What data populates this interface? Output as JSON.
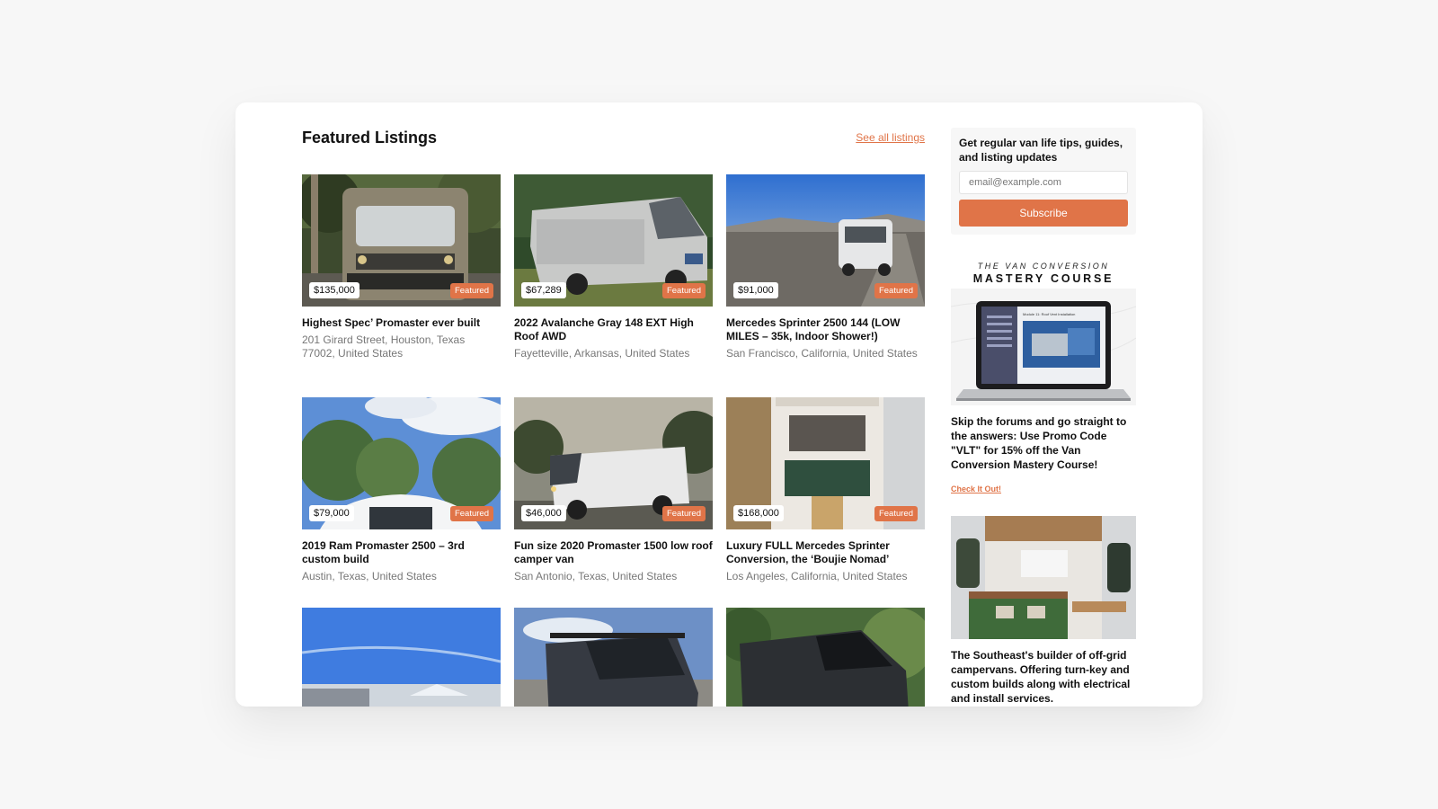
{
  "section": {
    "title": "Featured Listings",
    "see_all": "See all listings"
  },
  "listings": [
    {
      "price": "$135,000",
      "badge": "Featured",
      "title": "Highest Spec’ Promaster ever built",
      "location": "201 Girard Street, Houston, Texas 77002, United States"
    },
    {
      "price": "$67,289",
      "badge": "Featured",
      "title": "2022 Avalanche Gray 148 EXT High Roof AWD",
      "location": "Fayetteville, Arkansas, United States"
    },
    {
      "price": "$91,000",
      "badge": "Featured",
      "title": "Mercedes Sprinter 2500 144 (LOW MILES – 35k, Indoor Shower!)",
      "location": "San Francisco, California, United States"
    },
    {
      "price": "$79,000",
      "badge": "Featured",
      "title": "2019 Ram Promaster 2500 – 3rd custom build",
      "location": "Austin, Texas, United States"
    },
    {
      "price": "$46,000",
      "badge": "Featured",
      "title": "Fun size 2020 Promaster 1500 low roof camper van",
      "location": "San Antonio, Texas, United States"
    },
    {
      "price": "$168,000",
      "badge": "Featured",
      "title": "Luxury FULL Mercedes Sprinter Conversion, the ‘Boujie Nomad’",
      "location": "Los Angeles, California, United States"
    }
  ],
  "sidebar": {
    "newsletter": {
      "text": "Get regular van life tips, guides, and listing updates",
      "placeholder": "email@example.com",
      "button": "Subscribe"
    },
    "course": {
      "eyebrow": "THE VAN CONVERSION",
      "name": "MASTERY COURSE",
      "screen_caption": "Module 11: Roof Vent Installation",
      "promo": "Skip the forums and go straight to the answers: Use Promo Code \"VLT\" for 15% off the Van Conversion Mastery Course!",
      "link": "Check It Out!"
    },
    "builder_ad": {
      "text": "The Southeast's builder of off-grid campervans. Offering turn-key and custom builds along with electrical and install services."
    }
  },
  "colors": {
    "accent": "#e07448",
    "page_bg": "#f7f7f7",
    "card_bg": "#ffffff"
  }
}
